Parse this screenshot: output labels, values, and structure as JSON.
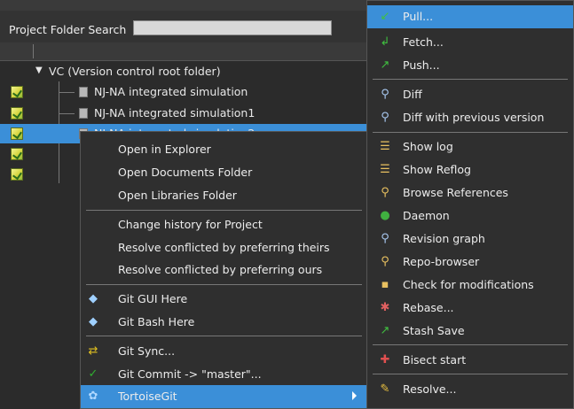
{
  "search": {
    "label": "Project Folder Search",
    "value": ""
  },
  "tree": {
    "root": "VC (Version control root folder)",
    "items": [
      {
        "label": "NJ-NA integrated simulation"
      },
      {
        "label": "NJ-NA integrated simulation1"
      },
      {
        "label": "NJ-NA integrated simulation2"
      }
    ]
  },
  "context_menu": {
    "items": [
      {
        "label": "Open in Explorer",
        "icon": ""
      },
      {
        "label": "Open Documents Folder",
        "icon": ""
      },
      {
        "label": "Open Libraries Folder",
        "icon": ""
      },
      {
        "label": "Change history for Project",
        "icon": ""
      },
      {
        "label": "Resolve conflicted by preferring theirs",
        "icon": ""
      },
      {
        "label": "Resolve conflicted by preferring ours",
        "icon": ""
      },
      {
        "label": "Git GUI Here",
        "icon": "git-gui-icon"
      },
      {
        "label": "Git Bash Here",
        "icon": "git-bash-icon"
      },
      {
        "label": "Git Sync...",
        "icon": "git-sync-icon"
      },
      {
        "label": "Git Commit -> \"master\"...",
        "icon": "git-commit-icon"
      },
      {
        "label": "TortoiseGit",
        "icon": "tortoisegit-icon"
      }
    ]
  },
  "submenu": {
    "items": [
      {
        "label": "Pull...",
        "icon": "pull-icon"
      },
      {
        "label": "Fetch...",
        "icon": "fetch-icon"
      },
      {
        "label": "Push...",
        "icon": "push-icon"
      },
      {
        "label": "Diff",
        "icon": "diff-icon"
      },
      {
        "label": "Diff with previous version",
        "icon": "diff-previous-icon"
      },
      {
        "label": "Show log",
        "icon": "show-log-icon"
      },
      {
        "label": "Show Reflog",
        "icon": "show-reflog-icon"
      },
      {
        "label": "Browse References",
        "icon": "browse-references-icon"
      },
      {
        "label": "Daemon",
        "icon": "daemon-icon"
      },
      {
        "label": "Revision graph",
        "icon": "revision-graph-icon"
      },
      {
        "label": "Repo-browser",
        "icon": "repo-browser-icon"
      },
      {
        "label": "Check for modifications",
        "icon": "check-modifications-icon"
      },
      {
        "label": "Rebase...",
        "icon": "rebase-icon"
      },
      {
        "label": "Stash Save",
        "icon": "stash-save-icon"
      },
      {
        "label": "Bisect start",
        "icon": "bisect-start-icon"
      },
      {
        "label": "Resolve...",
        "icon": "resolve-icon"
      }
    ]
  },
  "colors": {
    "selection": "#3b8fd8",
    "menu_bg": "#2f2f2f",
    "panel_bg": "#2b2b2b"
  }
}
